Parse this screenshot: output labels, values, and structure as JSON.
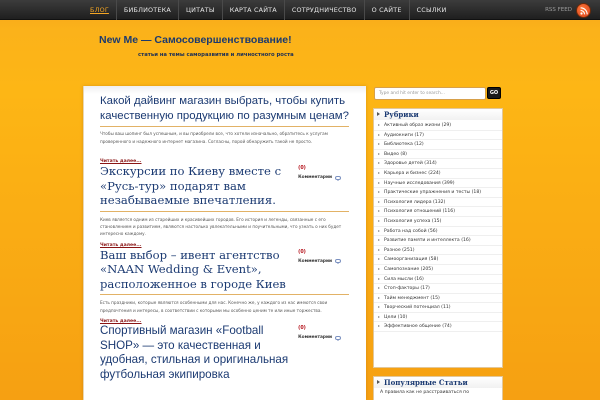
{
  "nav": {
    "items": [
      {
        "label": "БЛОГ",
        "active": true
      },
      {
        "label": "БИБЛИОТЕКА"
      },
      {
        "label": "ЦИТАТЫ"
      },
      {
        "label": "КАРТА САЙТА"
      },
      {
        "label": "СОТРУДНИЧЕСТВО"
      },
      {
        "label": "О САЙТЕ"
      },
      {
        "label": "ССЫЛКИ"
      }
    ],
    "rss_label": "RSS FEED",
    "rss_icon": "rss-icon"
  },
  "header": {
    "title": "New Me — Самосовершенствование!",
    "tagline": "статьи на темы саморазвития и личностного роста"
  },
  "posts": [
    {
      "title": "Какой дайвинг магазин выбрать, чтобы купить качественную продукцию по разумным ценам?",
      "excerpt": "Чтобы ваш шопинг был успешным, и вы приобрели все, что хотели изначально, обратитесь к услугам проверенного и надежного интернет магазина. Согласны, порой обнаружить такой не просто.",
      "read_more": "Читать далее..."
    },
    {
      "title": "Экскурсии по Киеву вместе с «Русь-тур» подарят вам незабываемые впечатления.",
      "comment_count": "(0)",
      "comment_label": "Комментарии",
      "excerpt": "Киев является одним из старейших и красивейших городов. Его история и легенды, связанные с его становлением и развитием, являются настолько увлекательными и поучительными, что узнать о них будет интересно каждому.",
      "read_more": "Читать далее..."
    },
    {
      "title": "Ваш выбор – ивент агентство «NAAN Wedding & Event», расположенное в городе Киев",
      "comment_count": "(0)",
      "comment_label": "Комментарии",
      "excerpt": "Есть праздники, которые являются особенными для нас. Конечно же, у каждого из нас имеются свои предпочтения и интересы, в соответствии с которыми мы особенно ценим те или иные торжества.",
      "read_more": "Читать далее..."
    },
    {
      "title": "Спортивный магазин «Football SHOP» — это качественная и удобная, стильная и оригинальная футбольная экипировка",
      "comment_count": "(0)",
      "comment_label": "Комментарии"
    }
  ],
  "sidebar": {
    "search_placeholder": "Type and hit enter to search...",
    "search_button": "GO",
    "categories_title": "Рубрики",
    "categories": [
      "Активный образ жизни (29)",
      "Аудиокниги (17)",
      "Библиотека (12)",
      "Видео (8)",
      "Здоровье детей (314)",
      "Карьера и бизнес (224)",
      "Научные исследования (399)",
      "Практические упражнения и тесты (18)",
      "Психология лидера (132)",
      "Психология отношений (116)",
      "Психология успеха (15)",
      "Работа над собой (56)",
      "Развитие памяти и интеллекта (16)",
      "Разное (251)",
      "Самоорганизация (58)",
      "Самопознание (205)",
      "Сила мысли (16)",
      "Стоп-факторы (17)",
      "Тайм менеджмент (15)",
      "Творческий потенциал (11)",
      "Цели (10)",
      "Эффективное общение (74)"
    ],
    "popular_title": "Популярные Статьи",
    "popular_text": "А правила как не расстраиваться по"
  }
}
